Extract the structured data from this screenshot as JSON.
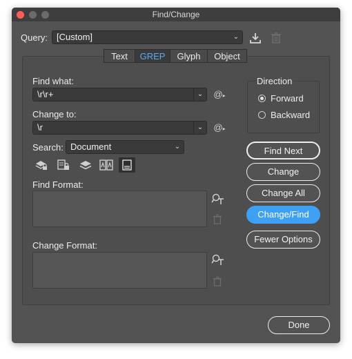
{
  "window": {
    "title": "Find/Change"
  },
  "query": {
    "label": "Query:",
    "value": "[Custom]"
  },
  "tabs": [
    {
      "label": "Text"
    },
    {
      "label": "GREP"
    },
    {
      "label": "Glyph"
    },
    {
      "label": "Object"
    }
  ],
  "find_what": {
    "label": "Find what:",
    "value": "\\r\\r+",
    "special_char_icon": "@"
  },
  "change_to": {
    "label": "Change to:",
    "value": "\\r",
    "special_char_icon": "@"
  },
  "search": {
    "label": "Search:",
    "value": "Document"
  },
  "find_format": {
    "label": "Find Format:"
  },
  "change_format": {
    "label": "Change Format:"
  },
  "direction": {
    "label": "Direction",
    "options": [
      {
        "label": "Forward",
        "selected": true
      },
      {
        "label": "Backward",
        "selected": false
      }
    ]
  },
  "buttons": {
    "find_next": "Find Next",
    "change": "Change",
    "change_all": "Change All",
    "change_find": "Change/Find",
    "fewer_options": "Fewer Options",
    "done": "Done"
  },
  "colors": {
    "background": "#535353",
    "accent": "#3ea0f5",
    "active_tab_text": "#5aaaf4"
  }
}
